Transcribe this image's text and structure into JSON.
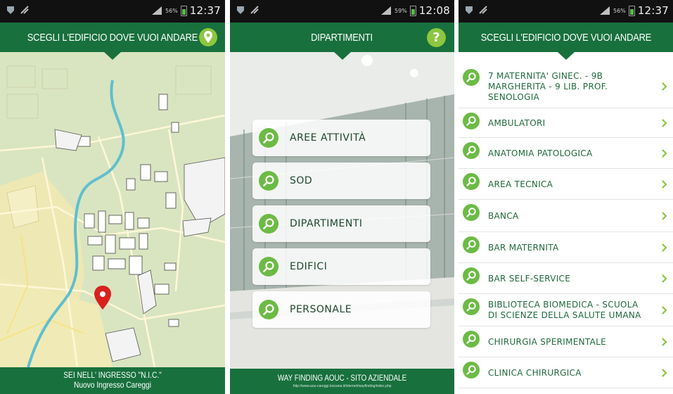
{
  "status_bars": [
    {
      "time": "12:37",
      "battery_pct": "56%"
    },
    {
      "time": "12:08",
      "battery_pct": "59%"
    },
    {
      "time": "12:37",
      "battery_pct": "56%"
    }
  ],
  "screen_map": {
    "header_title": "SCEGLI L'EDIFICIO DOVE VUOI ANDARE",
    "footer_line1": "SEI NELL' INGRESSO \"N.I.C.\"",
    "footer_line2": "Nuovo Ingresso Careggi"
  },
  "screen_menu": {
    "header_title": "DIPARTIMENTI",
    "help_label": "?",
    "items": [
      {
        "label": "AREE ATTIVITÀ"
      },
      {
        "label": "SOD"
      },
      {
        "label": "DIPARTIMENTI"
      },
      {
        "label": "EDIFICI"
      },
      {
        "label": "PERSONALE"
      }
    ],
    "footer_line1": "WAY FINDING AOUC - SITO AZIENDALE",
    "footer_line2": "http://www.aou-careggi.toscana.it/internet/wayfinding/index.php"
  },
  "screen_list": {
    "header_title": "SCEGLI L'EDIFICIO DOVE VUOI ANDARE",
    "items": [
      {
        "line1": "7 MATERNITA' GINEC. - 9B",
        "line2": "MARGHERITA - 9 LIB. PROF.",
        "line3": "SENOLOGIA"
      },
      {
        "line1": "AMBULATORI"
      },
      {
        "line1": "ANATOMIA PATOLOGICA"
      },
      {
        "line1": "AREA TECNICA"
      },
      {
        "line1": "BANCA"
      },
      {
        "line1": "BAR MATERNITA"
      },
      {
        "line1": "BAR SELF-SERVICE"
      },
      {
        "line1": "BIBLIOTECA BIOMEDICA - SCUOLA",
        "line2": "DI SCIENZE DELLA SALUTE UMANA"
      },
      {
        "line1": "CHIRURGIA SPERIMENTALE"
      },
      {
        "line1": "CLINICA CHIRURGICA"
      }
    ]
  },
  "colors": {
    "header_green": "#18703d",
    "accent_green": "#8dc63f",
    "text_green": "#1f6a3c"
  },
  "icons": [
    "signal-icon",
    "battery-icon",
    "location-pin-icon",
    "help-icon",
    "search-icon",
    "chevron-right-icon"
  ]
}
